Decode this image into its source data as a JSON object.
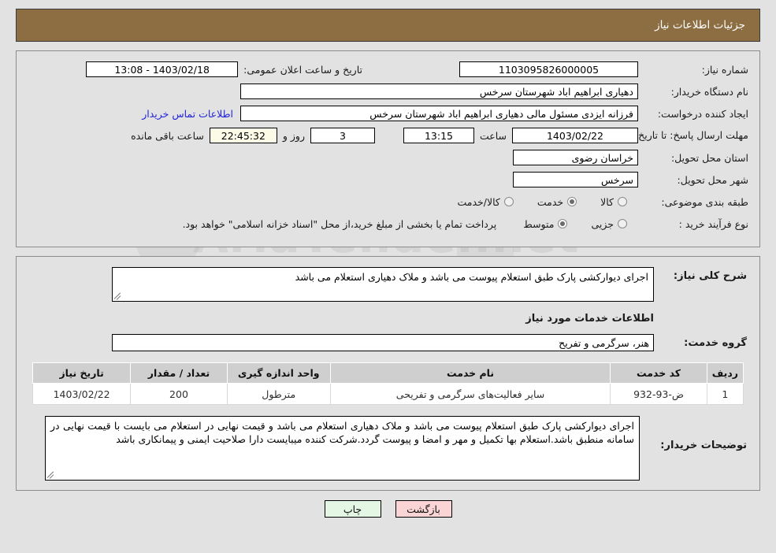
{
  "header": {
    "title": "جزئیات اطلاعات نیاز"
  },
  "watermark": {
    "text1": "AriaTender.net",
    "text2": "tender.net"
  },
  "info": {
    "need_number_label": "شماره نیاز:",
    "need_number_value": "1103095826000005",
    "announce_datetime_label": "تاریخ و ساعت اعلان عمومی:",
    "announce_datetime_value": "1403/02/18 - 13:08",
    "buyer_org_label": "نام دستگاه خریدار:",
    "buyer_org_value": "دهیاری ابراهیم اباد شهرستان سرخس",
    "requester_label": "ایجاد کننده درخواست:",
    "requester_value": "فرزانه ایزدی مسئول مالی دهیاری ابراهیم اباد شهرستان سرخس",
    "contact_link": "اطلاعات تماس خریدار",
    "deadline_label": "مهلت ارسال پاسخ: تا تاریخ:",
    "deadline_date": "1403/02/22",
    "hour_label": "ساعت",
    "deadline_time": "13:15",
    "days_value": "3",
    "days_label": "روز و",
    "remaining_value": "22:45:32",
    "remaining_label": "ساعت باقی مانده",
    "province_label": "استان محل تحویل:",
    "province_value": "خراسان رضوی",
    "city_label": "شهر محل تحویل:",
    "city_value": "سرخس",
    "category_label": "طبقه بندی موضوعی:",
    "category_options": [
      {
        "label": "کالا",
        "selected": false
      },
      {
        "label": "خدمت",
        "selected": true
      },
      {
        "label": "کالا/خدمت",
        "selected": false
      }
    ],
    "process_label": "نوع فرآیند خرید :",
    "process_options": [
      {
        "label": "جزیی",
        "selected": false
      },
      {
        "label": "متوسط",
        "selected": true
      }
    ],
    "payment_note": "پرداخت تمام یا بخشی از مبلغ خرید،از محل \"اسناد خزانه اسلامی\" خواهد بود."
  },
  "description": {
    "label": "شرح کلی نیاز:",
    "value": "اجرای دیوارکشی پارک   طبق استعلام پیوست می باشد و ملاک دهیاری استعلام می باشد"
  },
  "services": {
    "section_title": "اطلاعات خدمات مورد نیاز",
    "group_label": "گروه خدمت:",
    "group_value": "هنر، سرگرمی و تفریح",
    "columns": [
      "ردیف",
      "کد خدمت",
      "نام خدمت",
      "واحد اندازه گیری",
      "تعداد / مقدار",
      "تاریخ نیاز"
    ],
    "rows": [
      {
        "radif": "1",
        "code": "ض-93-932",
        "name": "سایر فعالیت‌های سرگرمی و تفریحی",
        "unit": "مترطول",
        "qty": "200",
        "date": "1403/02/22"
      }
    ]
  },
  "notes": {
    "label": "توضیحات خریدار:",
    "value": "اجرای دیوارکشی پارک   طبق استعلام پیوست می باشد و ملاک دهیاری استعلام می باشد و قیمت نهایی در استعلام می بایست با قیمت نهایی در سامانه منطبق باشد.استعلام بها تکمیل و مهر و امضا و پیوست گردد.شرکت کننده میبایست دارا صلاحیت ایمنی و پیمانکاری باشد"
  },
  "footer": {
    "back_label": "بازگشت",
    "print_label": "چاپ"
  },
  "colors": {
    "header_bg": "#8d6e43",
    "back_btn": "#fbd5d5",
    "print_btn": "#e4f6e4",
    "link": "#2222dd",
    "remaining_bg": "#fbfbe8",
    "table_header_bg": "#cfcfcf",
    "page_bg": "#e2e2e2"
  }
}
